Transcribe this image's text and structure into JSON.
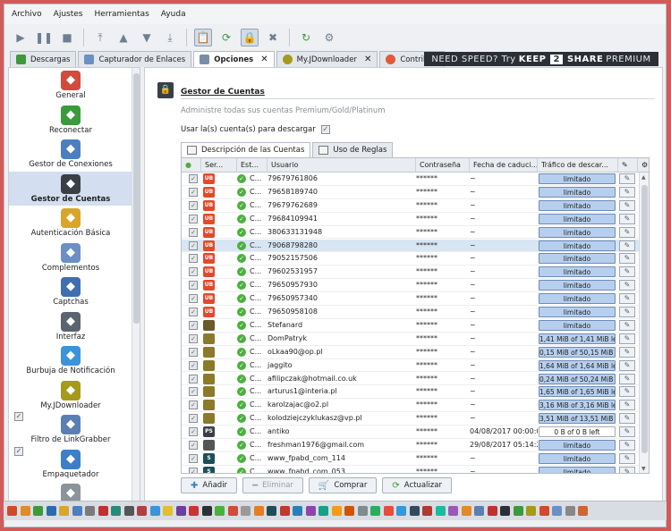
{
  "menu": [
    "Archivo",
    "Ajustes",
    "Herramientas",
    "Ayuda"
  ],
  "toolbar_icons": [
    "play-icon",
    "pause-icon",
    "stop-icon",
    "move-top-icon",
    "move-up-icon",
    "move-down-icon",
    "move-bottom-icon",
    "clipboard-icon",
    "reconnect-icon",
    "premium-icon",
    "clean-icon",
    "update-icon",
    "shutdown-icon"
  ],
  "tabs": [
    {
      "label": "Descargas",
      "icon": "download-icon",
      "closable": false
    },
    {
      "label": "Capturador de Enlaces",
      "icon": "linkgrabber-icon",
      "closable": false
    },
    {
      "label": "Opciones",
      "icon": "settings-icon",
      "closable": true
    },
    {
      "label": "My.JDownloader",
      "icon": "myjd-icon",
      "closable": true
    },
    {
      "label": "Contribuir",
      "icon": "heart-icon",
      "closable": false
    }
  ],
  "promo": {
    "part1": "NEED SPEED? Try",
    "part2": "KEEP",
    "part3": "2",
    "part4": "SHARE",
    "part5": "PREMIUM"
  },
  "sidebar": [
    {
      "label": "General",
      "icon": "home-icon",
      "color": "#d24a3a",
      "selected": false,
      "check": false
    },
    {
      "label": "Reconectar",
      "icon": "reconnect-icon",
      "color": "#3c9a3c",
      "selected": false,
      "check": false
    },
    {
      "label": "Gestor de Conexiones",
      "icon": "network-icon",
      "color": "#4d7fbf",
      "selected": false,
      "check": false
    },
    {
      "label": "Gestor de Cuentas",
      "icon": "account-manager-icon",
      "color": "#3a3f46",
      "selected": true,
      "check": false
    },
    {
      "label": "Autenticación Básica",
      "icon": "auth-icon",
      "color": "#d9a62a",
      "selected": false,
      "check": false
    },
    {
      "label": "Complementos",
      "icon": "plugins-icon",
      "color": "#6c8fc4",
      "selected": false,
      "check": false
    },
    {
      "label": "Captchas",
      "icon": "captcha-icon",
      "color": "#3f6fae",
      "selected": false,
      "check": false
    },
    {
      "label": "Interfaz",
      "icon": "interface-icon",
      "color": "#5b6470",
      "selected": false,
      "check": false
    },
    {
      "label": "Burbuja de Notificación",
      "icon": "bubble-icon",
      "color": "#3b93d9",
      "selected": false,
      "check": false
    },
    {
      "label": "My.JDownloader",
      "icon": "myjd-icon",
      "color": "#a59a1c",
      "selected": false,
      "check": false
    },
    {
      "label": "Filtro de LinkGrabber",
      "icon": "filter-icon",
      "color": "#5a7fb2",
      "selected": false,
      "check": true
    },
    {
      "label": "Empaquetador",
      "icon": "packager-icon",
      "color": "#3d7ec7",
      "selected": false,
      "check": true
    },
    {
      "label": "",
      "icon": "archive-icon",
      "color": "#8d939b",
      "selected": false,
      "check": false
    }
  ],
  "content": {
    "title": "Gestor de Cuentas",
    "subtitle": "Administre todas sus cuentas Premium/Gold/Platinum",
    "use_accounts_label": "Usar la(s) cuenta(s) para descargar",
    "subtabs": [
      "Descripción de las Cuentas",
      "Uso de Reglas"
    ]
  },
  "columns": [
    "",
    "Ser...",
    "Est...",
    "Usuario",
    "Contraseña",
    "Fecha de caduci...",
    "Tráfico de descar...",
    "",
    ""
  ],
  "rows": [
    {
      "host": "UB",
      "hc": "#e14a2b",
      "status": "C...",
      "user": "79679761806",
      "pass": "******",
      "date": "~",
      "traffic": "limitado",
      "white": false
    },
    {
      "host": "UB",
      "hc": "#e14a2b",
      "status": "C...",
      "user": "79658189740",
      "pass": "******",
      "date": "~",
      "traffic": "limitado",
      "white": false
    },
    {
      "host": "UB",
      "hc": "#e14a2b",
      "status": "C...",
      "user": "79679762689",
      "pass": "******",
      "date": "~",
      "traffic": "limitado",
      "white": false
    },
    {
      "host": "UB",
      "hc": "#e14a2b",
      "status": "C...",
      "user": "79684109941",
      "pass": "******",
      "date": "~",
      "traffic": "limitado",
      "white": false
    },
    {
      "host": "UB",
      "hc": "#e14a2b",
      "status": "C...",
      "user": "380633131948",
      "pass": "******",
      "date": "~",
      "traffic": "limitado",
      "white": false
    },
    {
      "host": "UB",
      "hc": "#e14a2b",
      "status": "C...",
      "user": "79068798280",
      "pass": "******",
      "date": "~",
      "traffic": "limitado",
      "white": false,
      "sel": true
    },
    {
      "host": "UB",
      "hc": "#e14a2b",
      "status": "C...",
      "user": "79052157506",
      "pass": "******",
      "date": "~",
      "traffic": "limitado",
      "white": false
    },
    {
      "host": "UB",
      "hc": "#e14a2b",
      "status": "C...",
      "user": "79602531957",
      "pass": "******",
      "date": "~",
      "traffic": "limitado",
      "white": false
    },
    {
      "host": "UB",
      "hc": "#e14a2b",
      "status": "C...",
      "user": "79650957930",
      "pass": "******",
      "date": "~",
      "traffic": "limitado",
      "white": false
    },
    {
      "host": "UB",
      "hc": "#e14a2b",
      "status": "C...",
      "user": "79650957340",
      "pass": "******",
      "date": "~",
      "traffic": "limitado",
      "white": false
    },
    {
      "host": "UB",
      "hc": "#e14a2b",
      "status": "C...",
      "user": "79650958108",
      "pass": "******",
      "date": "~",
      "traffic": "limitado",
      "white": false
    },
    {
      "host": "",
      "hc": "#6b5a2a",
      "status": "C...",
      "user": "Stefanard",
      "pass": "******",
      "date": "~",
      "traffic": "limitado",
      "white": false
    },
    {
      "host": "",
      "hc": "#8a7a2a",
      "status": "C...",
      "user": "DomPatryk",
      "pass": "******",
      "date": "~",
      "traffic": "1,41 MiB of 1,41 MiB left",
      "white": false
    },
    {
      "host": "",
      "hc": "#8a7a2a",
      "status": "C...",
      "user": "oLkaa90@op.pl",
      "pass": "******",
      "date": "~",
      "traffic": "0,15 MiB of 50,15 MiB left",
      "white": false
    },
    {
      "host": "",
      "hc": "#8a7a2a",
      "status": "C...",
      "user": "jaggito",
      "pass": "******",
      "date": "~",
      "traffic": "1,64 MiB of 1,64 MiB left",
      "white": false
    },
    {
      "host": "",
      "hc": "#8a7a2a",
      "status": "C...",
      "user": "afilipczak@hotmail.co.uk",
      "pass": "******",
      "date": "~",
      "traffic": "0,24 MiB of 50,24 MiB left",
      "white": false
    },
    {
      "host": "",
      "hc": "#8a7a2a",
      "status": "C...",
      "user": "arturus1@interia.pl",
      "pass": "******",
      "date": "~",
      "traffic": "1,65 MiB of 1,65 MiB left",
      "white": false
    },
    {
      "host": "",
      "hc": "#8a7a2a",
      "status": "C...",
      "user": "karolzajac@o2.pl",
      "pass": "******",
      "date": "~",
      "traffic": "3,16 MiB of 3,16 MiB left",
      "white": false
    },
    {
      "host": "",
      "hc": "#8a7a2a",
      "status": "C...",
      "user": "kolodziejczyklukasz@vp.pl",
      "pass": "******",
      "date": "~",
      "traffic": "3,51 MiB of 13,51 MiB left",
      "white": false
    },
    {
      "host": "PS",
      "hc": "#3a3f46",
      "status": "C...",
      "user": "antiko",
      "pass": "******",
      "date": "04/08/2017 00:00:00",
      "traffic": "0 B of 0 B left",
      "white": true
    },
    {
      "host": "",
      "hc": "#555",
      "status": "C...",
      "user": "freshman1976@gmail.com",
      "pass": "******",
      "date": "29/08/2017 05:14:20",
      "traffic": "limitado",
      "white": false
    },
    {
      "host": "S",
      "hc": "#1d4f5a",
      "status": "C...",
      "user": "www_fpabd_com_114",
      "pass": "******",
      "date": "~",
      "traffic": "limitado",
      "white": false
    },
    {
      "host": "S",
      "hc": "#1d4f5a",
      "status": "C...",
      "user": "www_fpabd_com_053",
      "pass": "******",
      "date": "~",
      "traffic": "limitado",
      "white": false
    }
  ],
  "buttons": [
    {
      "label": "Añadir",
      "icon": "plus-icon",
      "disabled": false
    },
    {
      "label": "Eliminar",
      "icon": "minus-icon",
      "disabled": true
    },
    {
      "label": "Comprar",
      "icon": "buy-icon",
      "disabled": false
    },
    {
      "label": "Actualizar",
      "icon": "refresh-icon",
      "disabled": false
    }
  ],
  "taskbar_colors": [
    "#d14a2a",
    "#e08a2a",
    "#3c9a3c",
    "#2b6cb0",
    "#d9a62a",
    "#4d7fbf",
    "#7a7a7a",
    "#c03030",
    "#2a8a7a",
    "#555555",
    "#b04040",
    "#3b93d9",
    "#e0c030",
    "#6b3fa0",
    "#cc3333",
    "#2b2f36",
    "#4ab13c",
    "#d24a3a",
    "#9a9a9a",
    "#e67e22",
    "#1d4f5a",
    "#c0392b",
    "#2980b9",
    "#8e44ad",
    "#16a085",
    "#f39c12",
    "#d35400",
    "#7f8c8d",
    "#27ae60",
    "#e74c3c",
    "#3498db",
    "#34495e",
    "#b03a2e",
    "#1abc9c",
    "#9b59b6",
    "#e08a2a",
    "#5a7fb2",
    "#c03030",
    "#2b2f36",
    "#3c9a3c",
    "#a59a1c",
    "#d14a2a",
    "#6c8fc4",
    "#888888",
    "#cc6633"
  ]
}
